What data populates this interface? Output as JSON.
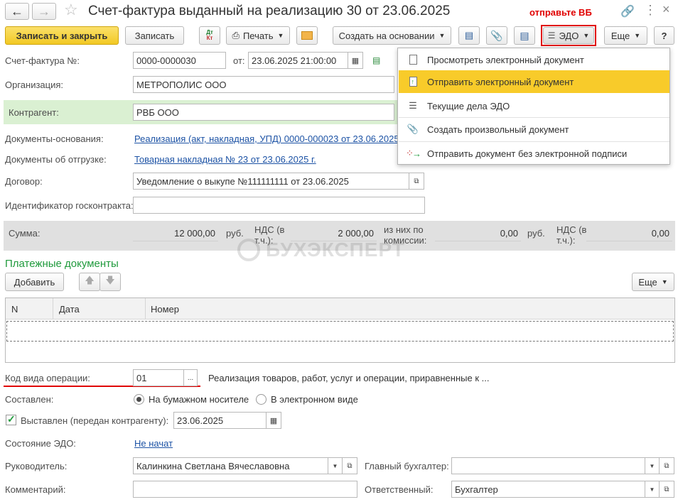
{
  "window": {
    "title": "Счет-фактура выданный на реализацию 30 от 23.06.2025",
    "back_icon": "arrow-left-icon",
    "forward_icon": "arrow-right-icon",
    "star_icon": "star-icon",
    "link_icon": "link-icon",
    "more_icon": "more-vertical-icon",
    "close_icon": "close-icon"
  },
  "annotation": {
    "text": "отправьте ВБ",
    "color": "#e00000"
  },
  "toolbar": {
    "save_close": "Записать и закрыть",
    "save": "Записать",
    "dt_kt": "Дт Кт",
    "print": "Печать",
    "create_based": "Создать на основании",
    "edo": "ЭДО",
    "more": "Еще",
    "help": "?"
  },
  "edo_menu": [
    {
      "label": "Просмотреть электронный документ",
      "icon": "document-icon"
    },
    {
      "label": "Отправить электронный документ",
      "icon": "send-document-icon",
      "highlighted": true
    },
    {
      "label": "Текущие дела ЭДО",
      "icon": "edo-tasks-icon"
    },
    {
      "label": "Создать произвольный документ",
      "icon": "paperclip-icon"
    },
    {
      "label": "Отправить документ без электронной подписи",
      "icon": "unsigned-send-icon"
    }
  ],
  "form": {
    "invoice_label": "Счет-фактура №:",
    "invoice_number": "0000-0000030",
    "from_label": "от:",
    "invoice_date": "23.06.2025 21:00:00",
    "org_label": "Организация:",
    "org_value": "МЕТРОПОЛИС ООО",
    "contractor_label": "Контрагент:",
    "contractor_value": "РВБ ООО",
    "base_docs_label": "Документы-основания:",
    "base_docs_value": "Реализация (акт, накладная, УПД) 0000-000023 от 23.06.2025",
    "ship_docs_label": "Документы об отгрузке:",
    "ship_docs_value": "Товарная накладная № 23 от 23.06.2025 г.",
    "contract_label": "Договор:",
    "contract_value": "Уведомление о выкупе №111111111 от 23.06.2025",
    "gov_id_label": "Идентификатор госконтракта:",
    "gov_id_value": ""
  },
  "sums": {
    "sum_label": "Сумма:",
    "sum_value": "12 000,00",
    "currency": "руб.",
    "vat_label": "НДС (в т.ч.):",
    "vat_value": "2 000,00",
    "commission_label": "из них по комиссии:",
    "commission_value": "0,00",
    "currency2": "руб.",
    "vat2_label": "НДС (в т.ч.):",
    "vat2_value": "0,00"
  },
  "watermark": "БУХЭКСПЕРТ",
  "payments": {
    "title": "Платежные документы",
    "add": "Добавить",
    "more": "Еще",
    "columns": [
      "N",
      "Дата",
      "Номер"
    ]
  },
  "operation": {
    "code_label": "Код вида операции:",
    "code_value": "01",
    "code_desc": "Реализация товаров, работ, услуг и операции, приравненные к ...",
    "compiled_label": "Составлен:",
    "paper": "На бумажном носителе",
    "electronic": "В электронном виде",
    "issued_label": "Выставлен (передан контрагенту):",
    "issued_date": "23.06.2025",
    "edo_state_label": "Состояние ЭДО:",
    "edo_state_value": "Не начат",
    "head_label": "Руководитель:",
    "head_value": "Калинкина Светлана Вячеславовна",
    "chief_acc_label": "Главный бухгалтер:",
    "chief_acc_value": "",
    "comment_label": "Комментарий:",
    "comment_value": "",
    "responsible_label": "Ответственный:",
    "responsible_value": "Бухгалтер"
  },
  "colors": {
    "primary_button": "#f7d33b",
    "highlight": "#f8cb2a",
    "green_row": "#daf0d2",
    "gray_band": "#e0e0e0",
    "red": "#e00000",
    "green_text": "#1f9a3c"
  }
}
